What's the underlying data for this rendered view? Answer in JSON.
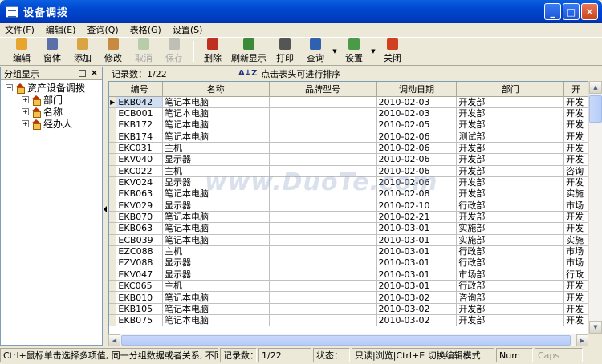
{
  "window": {
    "title": "设备调拨"
  },
  "menu": [
    "文件(F)",
    "编辑(E)",
    "查询(Q)",
    "表格(G)",
    "设置(S)"
  ],
  "toolbar": [
    {
      "label": "编辑",
      "icon": "edit-icon",
      "color": "#e7a530"
    },
    {
      "label": "窗体",
      "icon": "form-icon",
      "color": "#5b6fa8"
    },
    {
      "label": "添加",
      "icon": "add-icon",
      "color": "#d9a441"
    },
    {
      "label": "修改",
      "icon": "modify-icon",
      "color": "#c88a40"
    },
    {
      "label": "取消",
      "icon": "cancel-icon",
      "color": "#7aa870"
    },
    {
      "label": "保存",
      "icon": "save-icon",
      "color": "#8c8c8c"
    },
    {
      "label": "删除",
      "icon": "delete-icon",
      "color": "#c03020"
    },
    {
      "label": "刷新显示",
      "icon": "refresh-icon",
      "color": "#3a8a3a"
    },
    {
      "label": "打印",
      "icon": "print-icon",
      "color": "#555555"
    },
    {
      "label": "查询",
      "icon": "query-icon",
      "color": "#3060b0"
    },
    {
      "label": "设置",
      "icon": "settings-icon",
      "color": "#4a9a4a"
    },
    {
      "label": "关闭",
      "icon": "close-icon",
      "color": "#d04020"
    }
  ],
  "left_panel": {
    "header": "分组显示",
    "close": "×",
    "tree": {
      "root": "资产设备调拨",
      "children": [
        "部门",
        "名称",
        "经办人"
      ]
    }
  },
  "grid": {
    "record_count": "记录数：1/22",
    "sort_hint": "点击表头可进行排序",
    "columns": [
      "编号",
      "名称",
      "品牌型号",
      "调动日期",
      "部门",
      "开"
    ],
    "rows": [
      [
        "EKB042",
        "笔记本电脑",
        "",
        "2010-02-03",
        "开发部",
        "开发"
      ],
      [
        "ECB001",
        "笔记本电脑",
        "",
        "2010-02-03",
        "开发部",
        "开发"
      ],
      [
        "EKB172",
        "笔记本电脑",
        "",
        "2010-02-05",
        "开发部",
        "开发"
      ],
      [
        "EKB174",
        "笔记本电脑",
        "",
        "2010-02-06",
        "测试部",
        "开发"
      ],
      [
        "EKC031",
        "主机",
        "",
        "2010-02-06",
        "开发部",
        "开发"
      ],
      [
        "EKV040",
        "显示器",
        "",
        "2010-02-06",
        "开发部",
        "开发"
      ],
      [
        "EKC022",
        "主机",
        "",
        "2010-02-06",
        "开发部",
        "咨询"
      ],
      [
        "EKV024",
        "显示器",
        "",
        "2010-02-06",
        "开发部",
        "开发"
      ],
      [
        "EKB063",
        "笔记本电脑",
        "",
        "2010-02-08",
        "开发部",
        "实施"
      ],
      [
        "EKV029",
        "显示器",
        "",
        "2010-02-10",
        "行政部",
        "市场"
      ],
      [
        "EKB070",
        "笔记本电脑",
        "",
        "2010-02-21",
        "开发部",
        "开发"
      ],
      [
        "EKB063",
        "笔记本电脑",
        "",
        "2010-03-01",
        "实施部",
        "开发"
      ],
      [
        "ECB039",
        "笔记本电脑",
        "",
        "2010-03-01",
        "实施部",
        "实施"
      ],
      [
        "EZC088",
        "主机",
        "",
        "2010-03-01",
        "行政部",
        "市场"
      ],
      [
        "EZV088",
        "显示器",
        "",
        "2010-03-01",
        "行政部",
        "市场"
      ],
      [
        "EKV047",
        "显示器",
        "",
        "2010-03-01",
        "市场部",
        "行政"
      ],
      [
        "EKC065",
        "主机",
        "",
        "2010-03-01",
        "行政部",
        "开发"
      ],
      [
        "EKB010",
        "笔记本电脑",
        "",
        "2010-03-02",
        "咨询部",
        "开发"
      ],
      [
        "EKB105",
        "笔记本电脑",
        "",
        "2010-03-02",
        "开发部",
        "开发"
      ],
      [
        "EKB075",
        "笔记本电脑",
        "",
        "2010-03-02",
        "开发部",
        "开发"
      ]
    ]
  },
  "status": {
    "hint": "Ctrl+鼠标单击选择多项值, 同一分组数据或者关系, 不同",
    "records": "记录数：",
    "count": "1/22",
    "state_label": "状态：",
    "state": "只读|浏览|Ctrl+E 切换编辑模式",
    "num": "Num",
    "caps": "Caps"
  },
  "watermark": "www.DuoTe.com"
}
